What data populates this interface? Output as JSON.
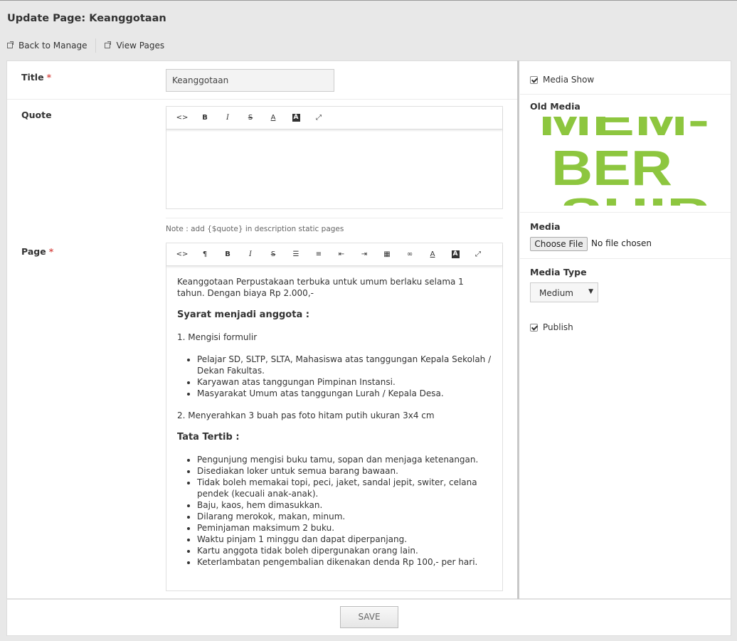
{
  "header": {
    "title": "Update Page: Keanggotaan",
    "back_label": "Back to Manage",
    "view_label": "View Pages"
  },
  "form": {
    "title_label": "Title",
    "required_mark": "*",
    "title_value": "Keanggotaan",
    "quote_label": "Quote",
    "quote_note": "Note : add {$quote} in description static pages",
    "page_label": "Page",
    "quote_toolbar": [
      "<>",
      "B",
      "I",
      "S",
      "A",
      "A",
      "expand"
    ],
    "page_toolbar": [
      "<>",
      "¶",
      "B",
      "I",
      "S",
      "ul",
      "ol",
      "outdent",
      "indent",
      "table",
      "link",
      "A",
      "A",
      "expand"
    ],
    "page_content": {
      "intro": "Keanggotaan Perpustakaan terbuka untuk umum berlaku selama 1 tahun. Dengan biaya Rp 2.000,-",
      "heading1": "Syarat menjadi anggota :",
      "step1": "1. Mengisi formulir",
      "step1_items": [
        "Pelajar SD, SLTP, SLTA, Mahasiswa atas tanggungan Kepala Sekolah / Dekan Fakultas.",
        "Karyawan atas tanggungan Pimpinan Instansi.",
        "Masyarakat Umum atas tanggungan Lurah / Kepala Desa."
      ],
      "step2": "2. Menyerahkan 3 buah pas foto hitam putih ukuran 3x4 cm",
      "heading2": "Tata Tertib :",
      "rules": [
        "Pengunjung mengisi buku tamu, sopan dan menjaga ketenangan.",
        "Disediakan loker untuk semua barang bawaan.",
        "Tidak boleh memakai topi, peci, jaket, sandal jepit, switer, celana pendek (kecuali anak-anak).",
        "Baju, kaos, hem dimasukkan.",
        "Dilarang merokok, makan, minum.",
        "Peminjaman maksimum 2 buku.",
        "Waktu pinjam 1 minggu dan dapat diperpanjang.",
        "Kartu anggota tidak boleh dipergunakan orang lain.",
        "Keterlambatan pengembalian dikenakan denda Rp 100,- per hari."
      ]
    },
    "save_label": "SAVE"
  },
  "sidebar": {
    "media_show_label": "Media Show",
    "media_show_checked": true,
    "old_media_label": "Old Media",
    "old_media_text": [
      "MEM-",
      "BER",
      "-SHIP"
    ],
    "old_media_color": "#8dc63f",
    "media_label": "Media",
    "choose_file_label": "Choose File",
    "no_file_text": "No file chosen",
    "media_type_label": "Media Type",
    "media_type_value": "Medium",
    "publish_label": "Publish",
    "publish_checked": true
  }
}
